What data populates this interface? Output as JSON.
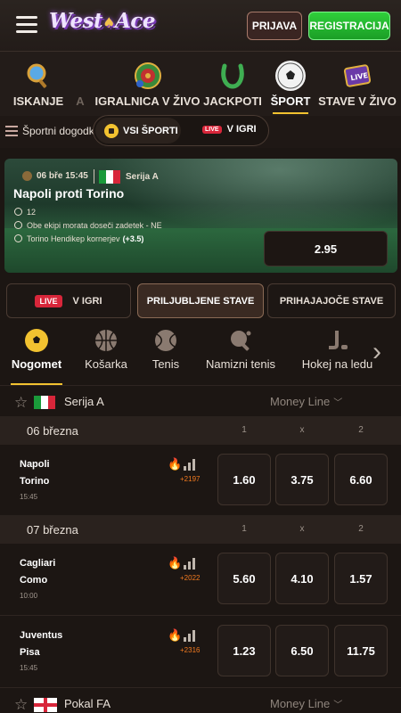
{
  "header": {
    "logo_text": "West",
    "logo_text2": "Ace",
    "login_label": "PRIJAVA",
    "register_label": "REGISTRACIJA"
  },
  "main_nav": [
    {
      "label": "ISKANJE",
      "icon": "search-icon"
    },
    {
      "label": "A",
      "icon": ""
    },
    {
      "label": "IGRALNICA V ŽIVO",
      "icon": "roulette-icon"
    },
    {
      "label": "JACKPOTI",
      "icon": "horseshoe-icon"
    },
    {
      "label": "ŠPORT",
      "icon": "soccer-ball-icon",
      "active": true
    },
    {
      "label": "STAVE V ŽIVO",
      "icon": "live-tv-icon"
    }
  ],
  "sub_nav": {
    "events_label": "Športni dogodki",
    "all_sports_label": "VSI ŠPORTI",
    "live_badge": "LIVE",
    "in_game_label": "V IGRI"
  },
  "banner": {
    "date": "06 bře 15:45",
    "league": "Serija A",
    "title": "Napoli proti Torino",
    "lines": [
      {
        "text": "12",
        "bold": ""
      },
      {
        "text": "Obe ekipi morata doseči zadetek - NE",
        "bold": ""
      },
      {
        "text": "Torino Hendikep kornerjev",
        "bold": "(+3.5)"
      }
    ],
    "odds": "2.95"
  },
  "tabs": {
    "live_badge": "LIVE",
    "in_game": "V IGRI",
    "favorites": "PRILJUBLJENE STAVE",
    "upcoming": "PRIHAJAJOČE STAVE"
  },
  "sports": [
    {
      "label": "Nogomet",
      "active": true
    },
    {
      "label": "Košarka"
    },
    {
      "label": "Tenis"
    },
    {
      "label": "Namizni tenis"
    },
    {
      "label": "Hokej na ledu"
    }
  ],
  "leagues": [
    {
      "name": "Serija A",
      "market": "Money Line",
      "dates": [
        {
          "label": "06 března",
          "cols": [
            "1",
            "x",
            "2"
          ],
          "matches": [
            {
              "team1": "Napoli",
              "team2": "Torino",
              "time": "15:45",
              "plus": "+2197",
              "odds": [
                "1.60",
                "3.75",
                "6.60"
              ]
            }
          ]
        },
        {
          "label": "07 března",
          "cols": [
            "1",
            "x",
            "2"
          ],
          "matches": [
            {
              "team1": "Cagliari",
              "team2": "Como",
              "time": "10:00",
              "plus": "+2022",
              "odds": [
                "5.60",
                "4.10",
                "1.57"
              ]
            },
            {
              "team1": "Juventus",
              "team2": "Pisa",
              "time": "15:45",
              "plus": "+2316",
              "odds": [
                "1.23",
                "6.50",
                "11.75"
              ]
            }
          ]
        }
      ]
    },
    {
      "name": "Pokal FA",
      "market": "Money Line"
    }
  ],
  "colors": {
    "accent": "#f2c230",
    "live": "#d8263a",
    "register": "#2fcf3a",
    "background": "#1c1613"
  }
}
